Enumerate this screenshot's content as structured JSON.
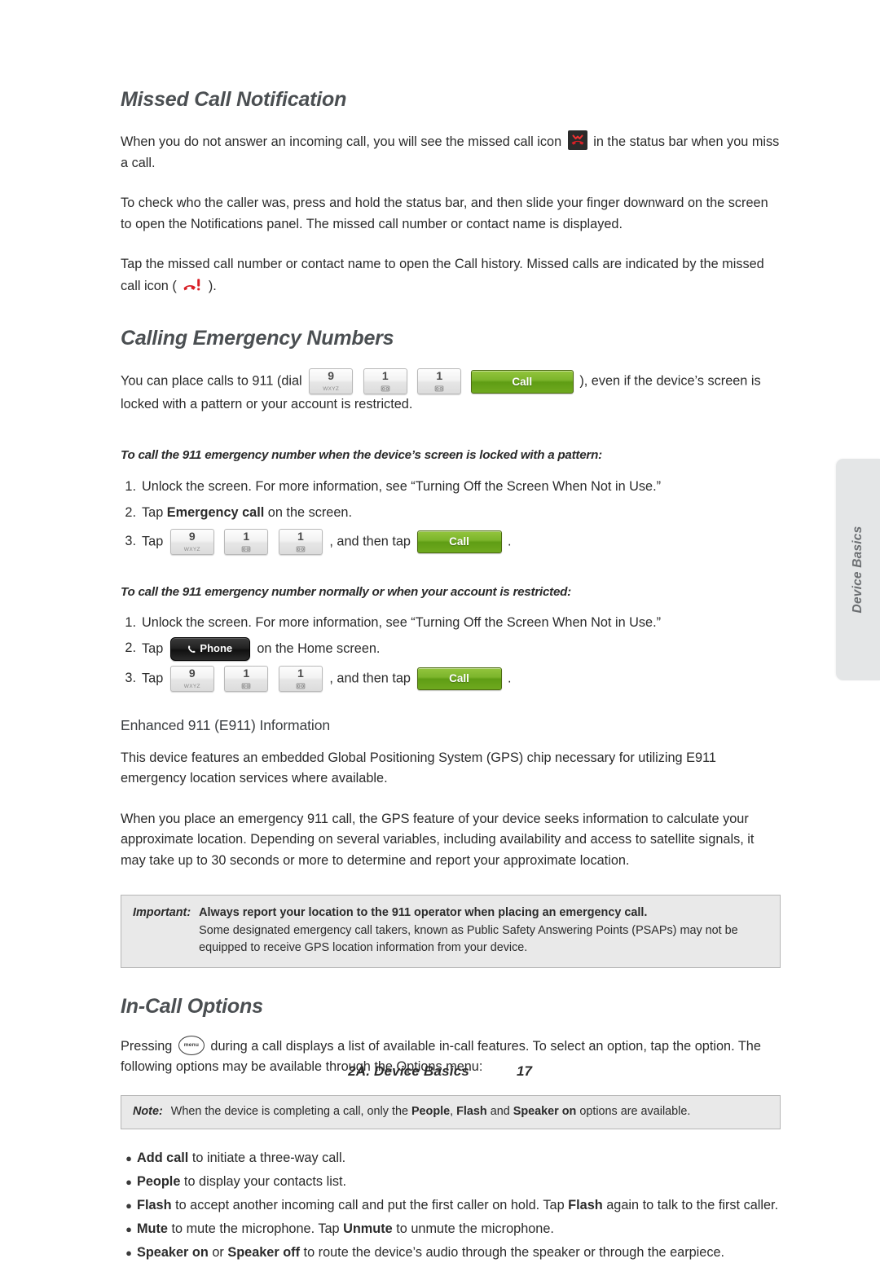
{
  "side_tab": {
    "label": "Device Basics"
  },
  "footer": {
    "title": "2A. Device Basics",
    "page": "17"
  },
  "sections": {
    "missed_call": {
      "heading": "Missed Call Notification",
      "p1_before": "When you do not answer an incoming call, you will see the missed call icon",
      "p1_after": "in the status bar when you miss a call.",
      "p2": "To check who the caller was, press and hold the status bar, and then slide your finger downward on the screen to open the Notifications panel. The missed call number or contact name is displayed.",
      "p3_before": "Tap the missed call number or contact name to open the Call history. Missed calls are indicated by the missed call icon (",
      "p3_after": ")."
    },
    "emergency": {
      "heading": "Calling Emergency Numbers",
      "intro_before": "You can place calls to 911 (dial",
      "intro_after": "), even if the device’s screen is locked with a pattern or your account is restricted.",
      "proc1": {
        "heading": "To call the 911 emergency number when the device’s screen is locked with a pattern:",
        "step1_num": "1.",
        "step1": "Unlock the screen. For more information, see “Turning Off the Screen When Not in Use.”",
        "step2_num": "2.",
        "step2_before": "Tap",
        "step2_bold": "Emergency call",
        "step2_after": "on the screen.",
        "step3_num": "3.",
        "step3_before": "Tap",
        "step3_middle": ", and then tap",
        "step3_after": "."
      },
      "proc2": {
        "heading": "To call the 911 emergency number normally or when your account is restricted:",
        "step1_num": "1.",
        "step1": "Unlock the screen. For more information, see “Turning Off the Screen When Not in Use.”",
        "step2_num": "2.",
        "step2_before": "Tap",
        "step2_after": "on the Home screen.",
        "step3_num": "3.",
        "step3_before": "Tap",
        "step3_middle": ", and then tap",
        "step3_after": "."
      },
      "e911": {
        "heading": "Enhanced 911 (E911) Information",
        "p1": "This device features an embedded Global Positioning System (GPS) chip necessary for utilizing E911 emergency location services where available.",
        "p2": "When you place an emergency 911 call, the GPS feature of your device seeks information to calculate your approximate location. Depending on several variables, including availability and access to satellite signals, it may take up to 30 seconds or more to determine and report your approximate location."
      },
      "important": {
        "tag": "Important:",
        "line1": "Always report your location to the 911 operator when placing an emergency call.",
        "line2": "Some designated emergency call takers, known as Public Safety Answering Points (PSAPs) may not be equipped to receive GPS location information from your device."
      }
    },
    "in_call": {
      "heading": "In-Call Options",
      "p1_before": "Pressing",
      "p1_after": "during a call displays a list of available in-call features. To select an option, tap the option. The following options may be available through the Options menu:",
      "note": {
        "tag": "Note:",
        "before": "When the device is completing a call, only the",
        "b1": "People",
        "sep1": ",",
        "b2": "Flash",
        "sep2": "and",
        "b3": "Speaker on",
        "after": "options are available."
      },
      "options": [
        {
          "bold": "Add call",
          "text": "to initiate a three-way call."
        },
        {
          "bold": "People",
          "text": "to display your contacts list."
        },
        {
          "bold": "Flash",
          "text": "to accept another incoming call and put the first caller on hold. Tap",
          "bold2": "Flash",
          "text2": "again to talk to the first caller."
        },
        {
          "bold": "Mute",
          "text": "to mute the microphone. Tap",
          "bold2": "Unmute",
          "text2": "to unmute the microphone."
        },
        {
          "bold": "Speaker on",
          "text": "or",
          "bold2": "Speaker off",
          "text2": "to route the device’s audio through the speaker or through the earpiece."
        }
      ]
    }
  },
  "buttons": {
    "call_label": "Call",
    "phone_label": "Phone",
    "menu_label": "menu"
  },
  "keys": {
    "nine": {
      "num": "9",
      "sub": "WXYZ"
    },
    "one": {
      "num": "1"
    }
  },
  "colors": {
    "call_green": "#6fa91f",
    "callout_bg": "#e9e9e9",
    "side_tab_bg": "#e4e6e7",
    "missed_red": "#d81f26"
  }
}
